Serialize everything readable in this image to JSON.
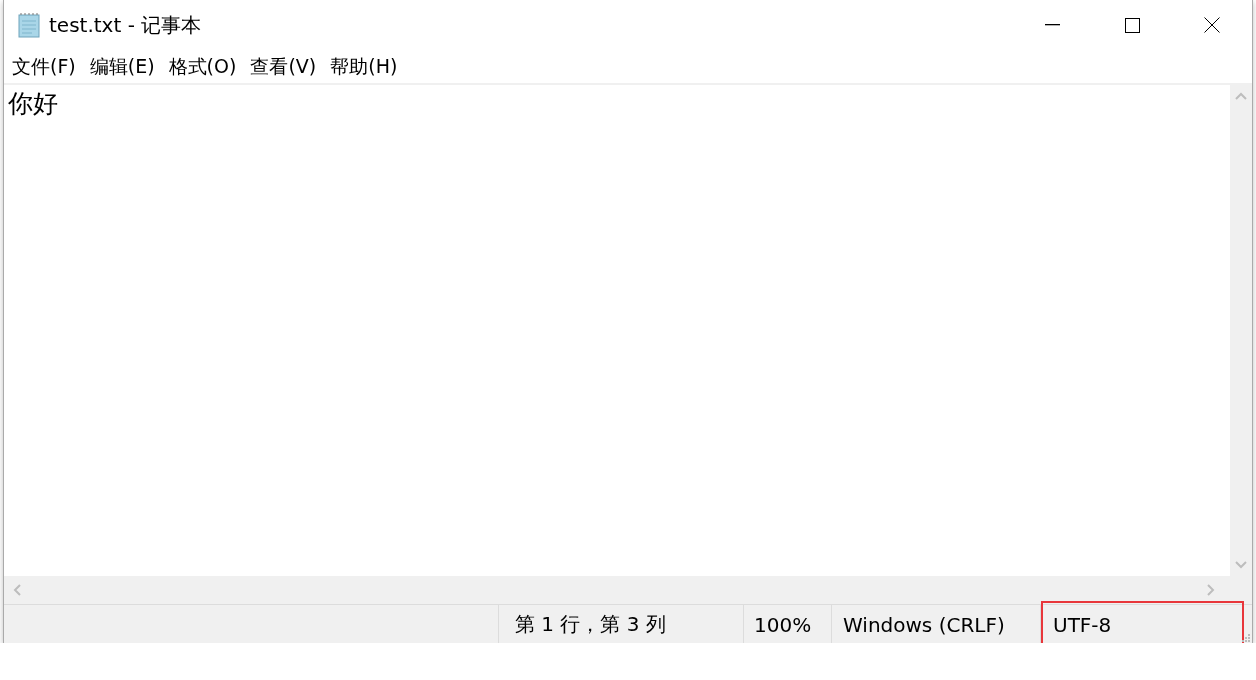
{
  "window": {
    "title": "test.txt - 记事本"
  },
  "menu": [
    {
      "label": "文件(F)"
    },
    {
      "label": "编辑(E)"
    },
    {
      "label": "格式(O)"
    },
    {
      "label": "查看(V)"
    },
    {
      "label": "帮助(H)"
    }
  ],
  "editor": {
    "text": "你好"
  },
  "status_bar": {
    "cells": [
      {
        "text": "第 1 行，第 3 列",
        "highlighted": false
      },
      {
        "text": "100%",
        "highlighted": false
      },
      {
        "text": "Windows (CRLF)",
        "highlighted": false
      },
      {
        "text": "UTF-8",
        "highlighted": true
      }
    ]
  }
}
